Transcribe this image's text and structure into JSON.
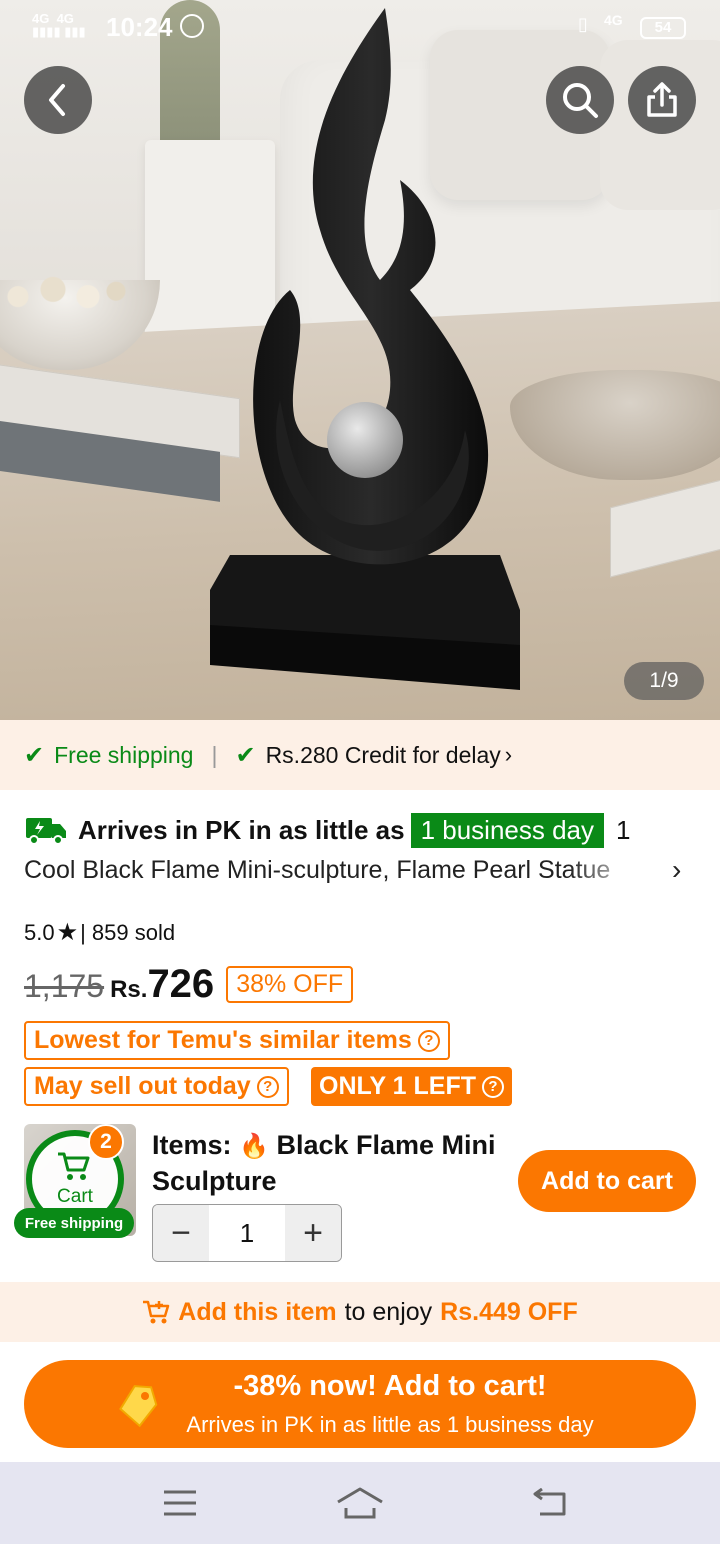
{
  "status_bar": {
    "time": "10:24",
    "network_left_1": "4G",
    "network_left_2": "4G",
    "network_right": "4G",
    "battery": "54"
  },
  "gallery": {
    "counter": "1/9"
  },
  "shipping_strip": {
    "free_shipping": "Free shipping",
    "divider": "|",
    "credit": "Rs.280 Credit for delay"
  },
  "delivery": {
    "prefix": "Arrives in PK in as little as",
    "badge": "1 business day",
    "suffix": "1"
  },
  "product": {
    "title": "Cool Black Flame Mini-sculpture, Flame Pearl Statue",
    "rating": "5.0",
    "sold": "| 859 sold",
    "old_price": "1,175",
    "currency": "Rs.",
    "price": "726",
    "discount": "38% OFF"
  },
  "tags": {
    "lowest": "Lowest for Temu's similar items",
    "sell_out": "May sell out today",
    "only_left": "ONLY 1 LEFT"
  },
  "cart": {
    "count": "2",
    "label": "Cart",
    "free_shipping": "Free shipping",
    "items_label": "Items:",
    "item_name": "Black Flame Mini Sculpture",
    "quantity": "1",
    "add_to_cart": "Add to cart"
  },
  "promo": {
    "link": "Add this item",
    "middle": "to enjoy",
    "amount": "Rs.449 OFF"
  },
  "cta": {
    "line1": "-38% now! Add to cart!",
    "line2": "Arrives in PK in as little as 1 business day"
  },
  "colors": {
    "accent": "#fb7701",
    "green": "#0a8a17",
    "strip_bg": "#fdf0e6"
  },
  "icons": [
    "back-icon",
    "search-icon",
    "share-icon",
    "check-icon",
    "truck-icon",
    "star-icon",
    "chevron-right-icon",
    "question-icon",
    "cart-icon",
    "fire-icon",
    "minus-icon",
    "plus-icon",
    "cart-add-icon",
    "price-tag-icon",
    "menu-icon",
    "home-icon",
    "back-nav-icon"
  ]
}
